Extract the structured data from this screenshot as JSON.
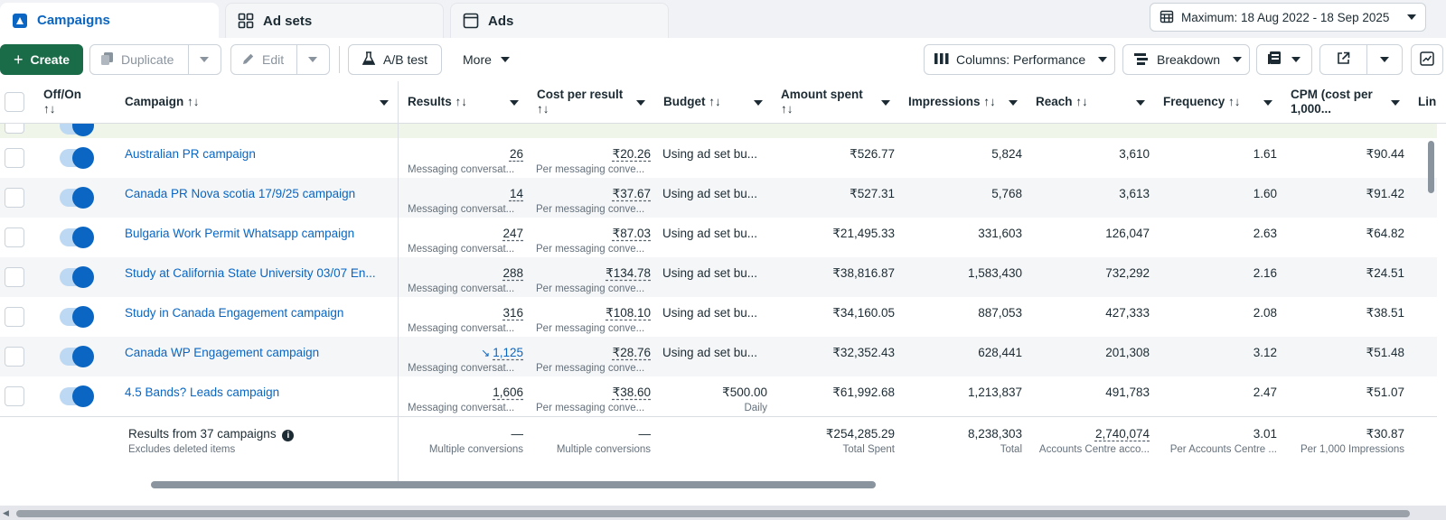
{
  "tabs": [
    {
      "label": "Campaigns",
      "icon": "campaign-icon"
    },
    {
      "label": "Ad sets",
      "icon": "grid-icon"
    },
    {
      "label": "Ads",
      "icon": "ad-window-icon"
    }
  ],
  "date_range": "Maximum: 18 Aug 2022 - 18 Sep 2025",
  "toolbar": {
    "create": "Create",
    "duplicate": "Duplicate",
    "edit": "Edit",
    "ab_test": "A/B test",
    "more": "More",
    "columns": "Columns: Performance",
    "breakdown": "Breakdown"
  },
  "columns": {
    "off_on": "Off/On",
    "campaign": "Campaign",
    "results": "Results",
    "cost_per_result": "Cost per result",
    "budget": "Budget",
    "amount_spent": "Amount spent",
    "impressions": "Impressions",
    "reach": "Reach",
    "frequency": "Frequency",
    "cpm": "CPM (cost per 1,000...",
    "cpm_line2": "1,000...",
    "link": "Lin"
  },
  "rows": [
    {
      "name": "Australian PR campaign",
      "results": "26",
      "results_sub": "Messaging conversat...",
      "cpr": "₹20.26",
      "cpr_sub": "Per messaging conve...",
      "budget": "Using ad set bu...",
      "budget_sub": "",
      "spent": "₹526.77",
      "impressions": "5,824",
      "reach": "3,610",
      "frequency": "1.61",
      "cpm": "₹90.44"
    },
    {
      "name": "Canada PR Nova scotia 17/9/25 campaign",
      "results": "14",
      "results_sub": "Messaging conversat...",
      "cpr": "₹37.67",
      "cpr_sub": "Per messaging conve...",
      "budget": "Using ad set bu...",
      "budget_sub": "",
      "spent": "₹527.31",
      "impressions": "5,768",
      "reach": "3,613",
      "frequency": "1.60",
      "cpm": "₹91.42"
    },
    {
      "name": "Bulgaria Work Permit Whatsapp campaign",
      "results": "247",
      "results_sub": "Messaging conversat...",
      "cpr": "₹87.03",
      "cpr_sub": "Per messaging conve...",
      "budget": "Using ad set bu...",
      "budget_sub": "",
      "spent": "₹21,495.33",
      "impressions": "331,603",
      "reach": "126,047",
      "frequency": "2.63",
      "cpm": "₹64.82"
    },
    {
      "name": "Study at California State University 03/07 En...",
      "results": "288",
      "results_sub": "Messaging conversat...",
      "cpr": "₹134.78",
      "cpr_sub": "Per messaging conve...",
      "budget": "Using ad set bu...",
      "budget_sub": "",
      "spent": "₹38,816.87",
      "impressions": "1,583,430",
      "reach": "732,292",
      "frequency": "2.16",
      "cpm": "₹24.51"
    },
    {
      "name": "Study in Canada Engagement campaign",
      "results": "316",
      "results_sub": "Messaging conversat...",
      "cpr": "₹108.10",
      "cpr_sub": "Per messaging conve...",
      "budget": "Using ad set bu...",
      "budget_sub": "",
      "spent": "₹34,160.05",
      "impressions": "887,053",
      "reach": "427,333",
      "frequency": "2.08",
      "cpm": "₹38.51"
    },
    {
      "name": "Canada WP Engagement campaign",
      "results": "1,125",
      "results_sub": "Messaging conversat...",
      "cpr": "₹28.76",
      "cpr_sub": "Per messaging conve...",
      "budget": "Using ad set bu...",
      "budget_sub": "",
      "spent": "₹32,352.43",
      "impressions": "628,441",
      "reach": "201,308",
      "frequency": "3.12",
      "cpm": "₹51.48"
    },
    {
      "name": "4.5 Bands? Leads campaign",
      "results": "1,606",
      "results_sub": "Messaging conversat...",
      "cpr": "₹38.60",
      "cpr_sub": "Per messaging conve...",
      "budget": "₹500.00",
      "budget_sub": "Daily",
      "spent": "₹61,992.68",
      "impressions": "1,213,837",
      "reach": "491,783",
      "frequency": "2.47",
      "cpm": "₹51.07"
    }
  ],
  "summary": {
    "title": "Results from 37 campaigns",
    "subtitle": "Excludes deleted items",
    "results": "—",
    "results_sub": "Multiple conversions",
    "cpr": "—",
    "cpr_sub": "Multiple conversions",
    "spent": "₹254,285.29",
    "spent_sub": "Total Spent",
    "impressions": "8,238,303",
    "impressions_sub": "Total",
    "reach": "2,740,074",
    "reach_sub": "Accounts Centre acco...",
    "frequency": "3.01",
    "frequency_sub": "Per Accounts Centre ...",
    "cpm": "₹30.87",
    "cpm_sub": "Per 1,000 Impressions"
  },
  "colors": {
    "accent": "#0a66c2",
    "create": "#1a6b47"
  }
}
